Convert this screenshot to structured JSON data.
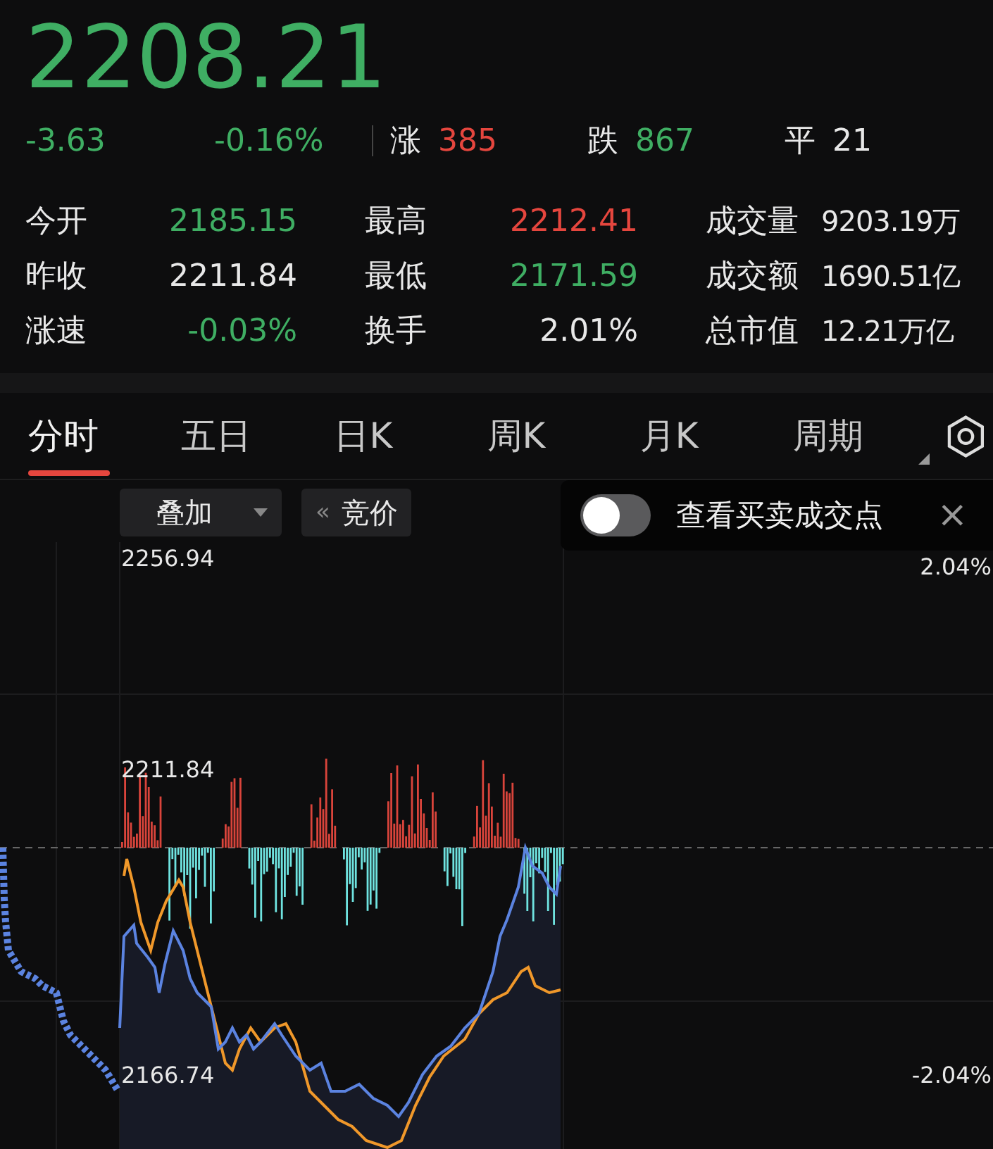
{
  "quote": {
    "price": "2208.21",
    "change": "-3.63",
    "change_pct": "-0.16%",
    "color": "#3fae63"
  },
  "breadth": [
    {
      "label": "涨",
      "count": "385",
      "color": "#e5463e"
    },
    {
      "label": "跌",
      "count": "867",
      "color": "#3fae63"
    },
    {
      "label": "平",
      "count": "21",
      "color": "#e8e8e8"
    }
  ],
  "stats": [
    {
      "label": "今开",
      "value": "2185.15",
      "color": "#3fae63"
    },
    {
      "label": "最高",
      "value": "2212.41",
      "color": "#e5463e"
    },
    {
      "label": "成交量",
      "value": "9203.19万",
      "color": "#e8e8e8"
    },
    {
      "label": "昨收",
      "value": "2211.84",
      "color": "#e8e8e8"
    },
    {
      "label": "最低",
      "value": "2171.59",
      "color": "#3fae63"
    },
    {
      "label": "成交额",
      "value": "1690.51亿",
      "color": "#e8e8e8"
    },
    {
      "label": "涨速",
      "value": "-0.03%",
      "color": "#3fae63"
    },
    {
      "label": "换手",
      "value": "2.01%",
      "color": "#e8e8e8"
    },
    {
      "label": "总市值",
      "value": "12.21万亿",
      "color": "#e8e8e8"
    }
  ],
  "tabs": [
    {
      "label": "分时",
      "selected": true,
      "has_menu": false
    },
    {
      "label": "五日",
      "selected": false,
      "has_menu": false
    },
    {
      "label": "日K",
      "selected": false,
      "has_menu": false
    },
    {
      "label": "周K",
      "selected": false,
      "has_menu": false
    },
    {
      "label": "月K",
      "selected": false,
      "has_menu": false
    },
    {
      "label": "周期",
      "selected": false,
      "has_menu": true
    }
  ],
  "toolbar": {
    "overlay": "叠加",
    "auction_icon": "«",
    "auction": "竞价"
  },
  "popup": {
    "toggle_on": false,
    "label": "查看买卖成交点",
    "close": "×"
  },
  "chart": {
    "price_high": "2256.94",
    "price_ref": "2211.84",
    "price_low": "2166.74",
    "pct_high": "2.04%",
    "pct_low": "-2.04%"
  }
}
